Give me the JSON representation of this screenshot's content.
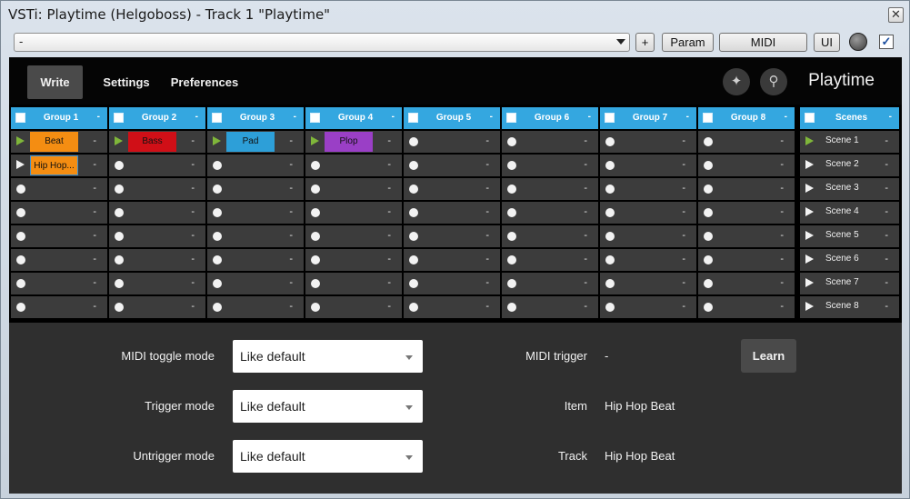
{
  "window": {
    "title": "VSTi: Playtime (Helgoboss) - Track 1 \"Playtime\"",
    "close_glyph": "✕"
  },
  "toolbar": {
    "preset_value": "-",
    "plus_label": "+",
    "param_label": "Param",
    "midi_label": "MIDI",
    "ui_label": "UI",
    "checkbox_checked": true
  },
  "header": {
    "tabs": [
      {
        "label": "Write",
        "active": true
      },
      {
        "label": "Settings",
        "active": false
      },
      {
        "label": "Preferences",
        "active": false
      }
    ],
    "icons": [
      "magic-wand-icon",
      "broom-icon"
    ],
    "app_title": "Playtime"
  },
  "groups": [
    {
      "name": "Group 1",
      "menu": "-",
      "slots": [
        {
          "state": "play",
          "clip": "Beat",
          "color": "#f48d12"
        },
        {
          "state": "play-white",
          "clip": "Hip Hop...",
          "color": "#f48d12"
        },
        {},
        {},
        {},
        {},
        {},
        {}
      ]
    },
    {
      "name": "Group 2",
      "menu": "-",
      "slots": [
        {
          "state": "play",
          "clip": "Bass",
          "color": "#d00f17"
        },
        {},
        {},
        {},
        {},
        {},
        {},
        {}
      ]
    },
    {
      "name": "Group 3",
      "menu": "-",
      "slots": [
        {
          "state": "play",
          "clip": "Pad",
          "color": "#2d9fd8"
        },
        {},
        {},
        {},
        {},
        {},
        {},
        {}
      ]
    },
    {
      "name": "Group 4",
      "menu": "-",
      "slots": [
        {
          "state": "play",
          "clip": "Plop",
          "color": "#9a3fc6"
        },
        {},
        {},
        {},
        {},
        {},
        {},
        {}
      ]
    },
    {
      "name": "Group 5",
      "menu": "-",
      "slots": [
        {},
        {},
        {},
        {},
        {},
        {},
        {},
        {}
      ]
    },
    {
      "name": "Group 6",
      "menu": "-",
      "slots": [
        {},
        {},
        {},
        {},
        {},
        {},
        {},
        {}
      ]
    },
    {
      "name": "Group 7",
      "menu": "-",
      "slots": [
        {},
        {},
        {},
        {},
        {},
        {},
        {},
        {}
      ]
    },
    {
      "name": "Group 8",
      "menu": "-",
      "slots": [
        {},
        {},
        {},
        {},
        {},
        {},
        {},
        {}
      ]
    }
  ],
  "slot_dash": "-",
  "scenes": {
    "title": "Scenes",
    "menu": "-",
    "items": [
      {
        "name": "Scene 1",
        "active": true
      },
      {
        "name": "Scene 2",
        "active": false
      },
      {
        "name": "Scene 3",
        "active": false
      },
      {
        "name": "Scene 4",
        "active": false
      },
      {
        "name": "Scene 5",
        "active": false
      },
      {
        "name": "Scene 6",
        "active": false
      },
      {
        "name": "Scene 7",
        "active": false
      },
      {
        "name": "Scene 8",
        "active": false
      }
    ]
  },
  "details": {
    "midi_toggle_label": "MIDI toggle mode",
    "midi_toggle_value": "Like default",
    "trigger_label": "Trigger mode",
    "trigger_value": "Like default",
    "untrigger_label": "Untrigger mode",
    "untrigger_value": "Like default",
    "midi_trigger_label": "MIDI trigger",
    "midi_trigger_value": "-",
    "learn_label": "Learn",
    "item_label": "Item",
    "item_value": "Hip Hop Beat",
    "track_label": "Track",
    "track_value": "Hip Hop Beat"
  }
}
